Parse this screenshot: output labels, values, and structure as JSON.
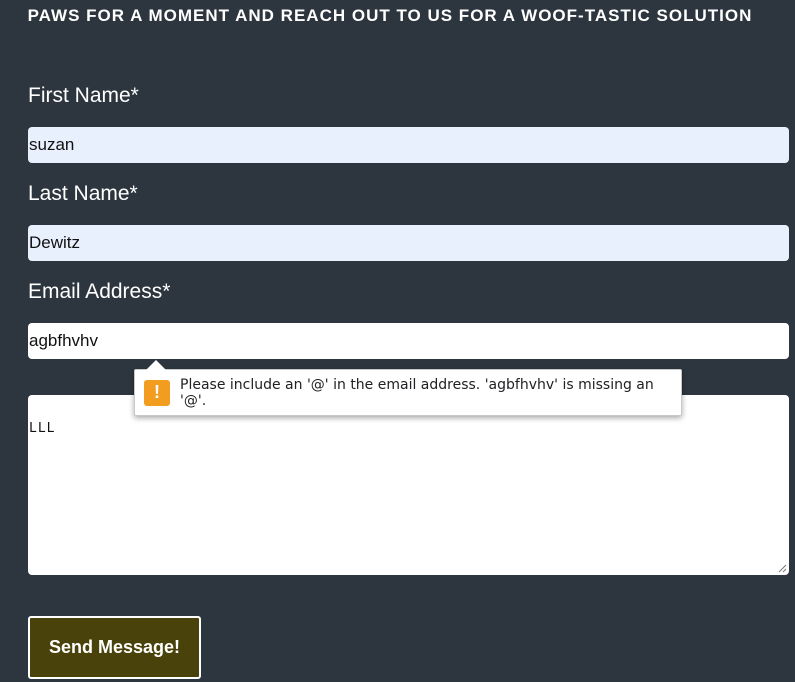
{
  "form": {
    "heading": "PAWS FOR A MOMENT AND REACH OUT TO US FOR A WOOF-TASTIC SOLUTION",
    "first_name": {
      "label": "First Name*",
      "value": "suzan"
    },
    "last_name": {
      "label": "Last Name*",
      "value": "Dewitz"
    },
    "email": {
      "label": "Email Address*",
      "value": "agbfhvhv"
    },
    "message": {
      "value": "LLL"
    },
    "submit_label": "Send Message!"
  },
  "validation_tooltip": {
    "icon": "warning-icon",
    "icon_glyph": "!",
    "text": "Please include an '@' in the email address. 'agbfhvhv' is missing an '@'."
  },
  "colors": {
    "background": "#2d363e",
    "autofill_field": "#e8f0fe",
    "button_bg": "#4a420b",
    "warning": "#f29d1f"
  }
}
